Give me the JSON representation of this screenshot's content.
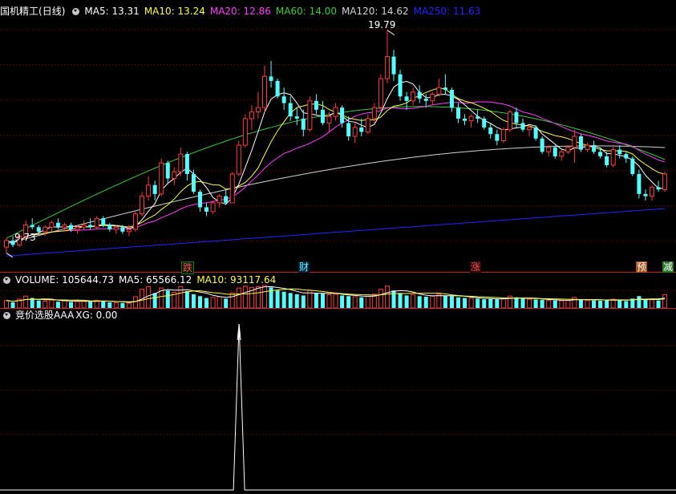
{
  "stock": {
    "name": "国机精工",
    "period": "(日线)"
  },
  "colors": {
    "up": "#ff3b3b",
    "down": "#54ffff",
    "grid": "#8b0000",
    "ma5": "#ffffff",
    "ma10": "#ffff3c",
    "ma20": "#ff3cff",
    "ma60": "#3ccc3c",
    "ma120": "#d2d2d2",
    "ma250": "#2424ff",
    "vol_ma5": "#ffffff",
    "vol_ma10": "#ffff3c"
  },
  "price_legend": {
    "ma5": "MA5: 13.31",
    "ma10": "MA10: 13.24",
    "ma20": "MA20: 12.86",
    "ma60": "MA60: 14.00",
    "ma120": "MA120: 14.62",
    "ma250": "MA250: 11.63"
  },
  "annotations": {
    "high": "19.79",
    "low": "9.73"
  },
  "event_tags": [
    "跌",
    "财",
    "涨",
    "预",
    "减"
  ],
  "volume_legend": {
    "volume": "VOLUME: 105644.73",
    "ma5": "MA5: 65566.12",
    "ma10": "MA10: 93117.64"
  },
  "indicator_legend": {
    "name": "竞价选股AAA",
    "xg": "XG: 0.00"
  },
  "chart_data": [
    {
      "type": "candlestick",
      "title": "国机精工(日线)",
      "ylim": [
        9.5,
        20.5
      ],
      "candles": [
        [
          10.0,
          10.4,
          9.73,
          10.3
        ],
        [
          10.3,
          10.5,
          10.0,
          10.1
        ],
        [
          10.1,
          10.6,
          10.0,
          10.5
        ],
        [
          10.5,
          11.2,
          10.4,
          11.0
        ],
        [
          11.0,
          11.3,
          10.8,
          10.9
        ],
        [
          10.9,
          11.0,
          10.6,
          10.7
        ],
        [
          10.7,
          11.0,
          10.5,
          10.9
        ],
        [
          10.9,
          11.2,
          10.7,
          11.1
        ],
        [
          11.1,
          11.3,
          10.8,
          10.9
        ],
        [
          10.9,
          11.1,
          10.7,
          11.0
        ],
        [
          11.0,
          11.1,
          10.7,
          10.8
        ],
        [
          10.8,
          11.0,
          10.6,
          10.9
        ],
        [
          10.9,
          11.2,
          10.8,
          11.0
        ],
        [
          11.0,
          11.3,
          10.8,
          10.9
        ],
        [
          10.9,
          11.4,
          10.8,
          11.3
        ],
        [
          11.3,
          11.4,
          10.9,
          11.0
        ],
        [
          11.0,
          11.1,
          10.7,
          10.8
        ],
        [
          10.8,
          11.0,
          10.6,
          10.9
        ],
        [
          10.9,
          11.0,
          10.6,
          10.7
        ],
        [
          10.7,
          11.0,
          10.5,
          10.8
        ],
        [
          10.8,
          11.6,
          10.7,
          11.5
        ],
        [
          11.5,
          12.5,
          11.4,
          12.3
        ],
        [
          12.3,
          13.2,
          12.1,
          12.8
        ],
        [
          12.8,
          13.0,
          12.1,
          12.4
        ],
        [
          12.4,
          14.0,
          12.3,
          13.8
        ],
        [
          13.8,
          13.9,
          12.9,
          13.1
        ],
        [
          13.1,
          13.6,
          12.8,
          13.4
        ],
        [
          13.4,
          14.5,
          13.2,
          14.2
        ],
        [
          14.2,
          14.3,
          13.0,
          13.3
        ],
        [
          13.3,
          13.5,
          12.4,
          12.5
        ],
        [
          12.5,
          12.6,
          11.6,
          11.8
        ],
        [
          11.8,
          12.0,
          11.4,
          11.6
        ],
        [
          11.6,
          12.1,
          11.5,
          12.0
        ],
        [
          12.0,
          12.4,
          11.8,
          12.3
        ],
        [
          12.3,
          12.6,
          11.9,
          12.0
        ],
        [
          12.0,
          13.4,
          12.0,
          13.3
        ],
        [
          13.3,
          14.8,
          13.2,
          14.6
        ],
        [
          14.6,
          16.0,
          14.5,
          15.8
        ],
        [
          15.8,
          16.4,
          15.3,
          16.1
        ],
        [
          16.1,
          17.0,
          15.8,
          16.3
        ],
        [
          16.3,
          18.2,
          16.1,
          17.7
        ],
        [
          17.7,
          18.4,
          17.2,
          17.5
        ],
        [
          17.5,
          17.6,
          16.7,
          16.8
        ],
        [
          16.8,
          17.2,
          16.2,
          16.5
        ],
        [
          16.5,
          16.8,
          15.7,
          15.9
        ],
        [
          15.9,
          16.3,
          15.5,
          15.8
        ],
        [
          15.8,
          16.2,
          15.0,
          15.3
        ],
        [
          15.3,
          16.8,
          15.2,
          16.6
        ],
        [
          16.6,
          16.9,
          16.0,
          16.2
        ],
        [
          16.2,
          16.6,
          15.5,
          15.6
        ],
        [
          15.6,
          16.1,
          15.2,
          15.9
        ],
        [
          15.9,
          16.5,
          15.7,
          16.3
        ],
        [
          16.3,
          16.4,
          15.4,
          15.6
        ],
        [
          15.6,
          15.9,
          14.8,
          15.0
        ],
        [
          15.0,
          15.6,
          14.7,
          15.4
        ],
        [
          15.4,
          15.8,
          15.0,
          15.2
        ],
        [
          15.2,
          16.0,
          15.1,
          15.8
        ],
        [
          15.8,
          16.5,
          15.6,
          16.3
        ],
        [
          16.3,
          17.8,
          16.2,
          17.6
        ],
        [
          17.6,
          19.79,
          17.4,
          18.6
        ],
        [
          18.6,
          18.9,
          17.5,
          17.8
        ],
        [
          17.8,
          18.0,
          16.6,
          16.8
        ],
        [
          16.8,
          17.0,
          16.2,
          16.6
        ],
        [
          16.6,
          17.2,
          16.4,
          17.0
        ],
        [
          17.0,
          17.3,
          16.5,
          16.7
        ],
        [
          16.7,
          16.9,
          16.3,
          16.6
        ],
        [
          16.6,
          17.0,
          16.4,
          16.9
        ],
        [
          16.9,
          17.6,
          16.8,
          17.2
        ],
        [
          17.2,
          17.8,
          16.9,
          17.1
        ],
        [
          17.1,
          17.2,
          16.1,
          16.3
        ],
        [
          16.3,
          16.5,
          15.6,
          15.8
        ],
        [
          15.8,
          16.0,
          15.5,
          15.7
        ],
        [
          15.7,
          16.0,
          15.4,
          15.9
        ],
        [
          15.9,
          16.2,
          15.6,
          15.8
        ],
        [
          15.8,
          15.9,
          15.3,
          15.4
        ],
        [
          15.4,
          15.6,
          14.9,
          15.1
        ],
        [
          15.1,
          15.3,
          14.6,
          14.8
        ],
        [
          14.8,
          15.4,
          14.7,
          15.3
        ],
        [
          15.3,
          16.2,
          15.2,
          16.1
        ],
        [
          16.1,
          16.3,
          15.4,
          15.6
        ],
        [
          15.6,
          15.8,
          15.2,
          15.3
        ],
        [
          15.3,
          15.5,
          15.0,
          15.4
        ],
        [
          15.4,
          15.5,
          14.8,
          14.9
        ],
        [
          14.9,
          15.0,
          14.2,
          14.3
        ],
        [
          14.3,
          14.6,
          14.1,
          14.5
        ],
        [
          14.5,
          14.6,
          14.0,
          14.1
        ],
        [
          14.1,
          14.4,
          13.9,
          14.3
        ],
        [
          14.3,
          14.6,
          14.2,
          14.5
        ],
        [
          14.5,
          15.3,
          13.8,
          15.0
        ],
        [
          15.0,
          15.1,
          14.3,
          14.4
        ],
        [
          14.4,
          14.7,
          14.3,
          14.6
        ],
        [
          14.6,
          14.8,
          14.2,
          14.3
        ],
        [
          14.3,
          14.5,
          14.0,
          14.1
        ],
        [
          14.1,
          14.3,
          13.6,
          13.7
        ],
        [
          13.7,
          14.6,
          13.6,
          14.4
        ],
        [
          14.4,
          14.6,
          14.0,
          14.2
        ],
        [
          14.2,
          14.3,
          13.8,
          14.0
        ],
        [
          14.0,
          14.1,
          13.2,
          13.3
        ],
        [
          13.3,
          13.5,
          12.2,
          12.4
        ],
        [
          12.4,
          12.6,
          12.1,
          12.3
        ],
        [
          12.3,
          12.8,
          12.1,
          12.7
        ],
        [
          12.7,
          13.0,
          12.5,
          12.6
        ],
        [
          12.6,
          13.4,
          12.5,
          13.3
        ]
      ]
    },
    {
      "type": "bar",
      "title": "VOLUME",
      "ylim": [
        0,
        180000
      ],
      "values": [
        60000,
        45000,
        70000,
        95000,
        80000,
        60000,
        55000,
        65000,
        50000,
        60000,
        48000,
        52000,
        55000,
        50000,
        62000,
        58000,
        45000,
        42000,
        40000,
        38000,
        90000,
        150000,
        170000,
        120000,
        160000,
        140000,
        125000,
        170000,
        135000,
        110000,
        95000,
        80000,
        85000,
        90000,
        75000,
        120000,
        160000,
        175000,
        165000,
        170000,
        180000,
        165000,
        140000,
        130000,
        120000,
        110000,
        100000,
        140000,
        120000,
        115000,
        105000,
        110000,
        100000,
        95000,
        90000,
        85000,
        95000,
        110000,
        150000,
        175000,
        140000,
        120000,
        100000,
        105000,
        95000,
        90000,
        95000,
        110000,
        100000,
        95000,
        85000,
        80000,
        78000,
        75000,
        70000,
        72000,
        70000,
        75000,
        95000,
        85000,
        75000,
        70000,
        68000,
        65000,
        62000,
        60000,
        58000,
        60000,
        85000,
        70000,
        62000,
        60000,
        58000,
        65000,
        70000,
        60000,
        55000,
        75000,
        95000,
        70000,
        65000,
        60000,
        105644.73
      ],
      "ma5_last": 65566.12,
      "ma10_last": 93117.64
    },
    {
      "type": "line",
      "title": "竞价选股AAA",
      "ylim": [
        0,
        1
      ],
      "spike_index": 42,
      "xg_last": 0.0
    }
  ]
}
